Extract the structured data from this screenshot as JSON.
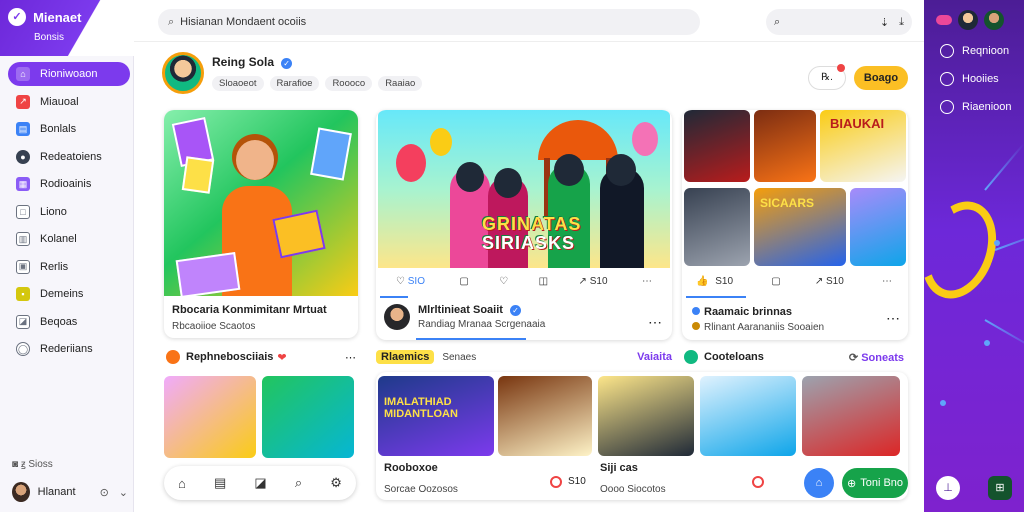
{
  "brand": {
    "name": "Mienaet",
    "subtitle": "Bonsis",
    "logo_glyph": "✓"
  },
  "sidebar": {
    "items": [
      {
        "label": "Rioniwoaon",
        "icon": "home-icon",
        "color": "#7c3aed",
        "glyph": "⌂",
        "active": true
      },
      {
        "label": "Miauoal",
        "icon": "chart-icon",
        "color": "#ef4444",
        "glyph": "↗"
      },
      {
        "label": "Bonlals",
        "icon": "book-icon",
        "color": "#3b82f6",
        "glyph": "▤"
      },
      {
        "label": "Redeatoiens",
        "icon": "user-icon",
        "color": "#374151",
        "glyph": "●"
      },
      {
        "label": "Rodioainis",
        "icon": "grid-icon",
        "color": "#8b5cf6",
        "glyph": "▦"
      },
      {
        "label": "Liono",
        "icon": "square-icon",
        "color": "#6b7280",
        "glyph": "□"
      },
      {
        "label": "Kolanel",
        "icon": "doc-icon",
        "color": "#6b7280",
        "glyph": "▥"
      },
      {
        "label": "Rerlis",
        "icon": "bookmark-icon",
        "color": "#6b7280",
        "glyph": "▣"
      },
      {
        "label": "Demeins",
        "icon": "folder-icon",
        "color": "#d4c70e",
        "glyph": "▪"
      },
      {
        "label": "Beqoas",
        "icon": "image-icon",
        "color": "#6b7280",
        "glyph": "◪"
      },
      {
        "label": "Rederiians",
        "icon": "chat-icon",
        "color": "#6b7280",
        "glyph": "◯"
      }
    ],
    "footer": "◙ ꙃ Sioss",
    "user": {
      "name": "Hlanant",
      "action_glyph": "⊙",
      "menu_glyph": "⌄"
    }
  },
  "topbar": {
    "search_value": "Hisianan Mondaent ocoiis",
    "right_icons": [
      "⌕",
      "⇣",
      "⤓"
    ]
  },
  "profile": {
    "name": "Reing Sola",
    "chips": [
      "Sloaoeot",
      "Rarafioe",
      "Roooco",
      "Raaiao"
    ],
    "message_label": "℞.",
    "follow_label": "Boago"
  },
  "card1": {
    "title": "Rbocaria Konmimitanr Mrtuat",
    "subtitle": "Rbcaoiioe Scaotos"
  },
  "card2": {
    "poster_line1": "GRINATAS",
    "poster_line2": "SIRIASKS",
    "likes": "SIO",
    "author_title": "Mlrltinieat Soaiit",
    "author_sub": "Randiag Mranaa Scrgenaaia"
  },
  "card3": {
    "likes": "S10",
    "title": "Raamaic brinnas",
    "subtitle": "Rlinant Aarananiis Sooaien"
  },
  "section1": {
    "title": "Rephnebosciiais"
  },
  "section2": {
    "tag": "Rlaemics",
    "title": "Senaes",
    "link": "Vaiaita"
  },
  "section3": {
    "title": "Cooteloans",
    "link": "Soneats"
  },
  "row_items": [
    {
      "title": "Rooboxoe",
      "sub": "Sorcae Oozosos"
    },
    {
      "title": "Siji cas",
      "sub": "Oooo Siocotos"
    }
  ],
  "poster_row": {
    "line1": "IMALATHIAD",
    "line2": "MIDANTLOAN"
  },
  "card3_posters": {
    "a": "BIAUKAI",
    "b": "SICAARS"
  },
  "counts": {
    "shared": "S10",
    "small": "S10"
  },
  "fab": {
    "label": "Toni Bno"
  },
  "rail": {
    "items": [
      {
        "label": "Reqnioon"
      },
      {
        "label": "Hooiies"
      },
      {
        "label": "Riaenioon"
      }
    ]
  },
  "colors": {
    "accent": "#7c3aed",
    "follow": "#fbbf24",
    "primary_blue": "#3b82f6",
    "success": "#16a34a"
  }
}
